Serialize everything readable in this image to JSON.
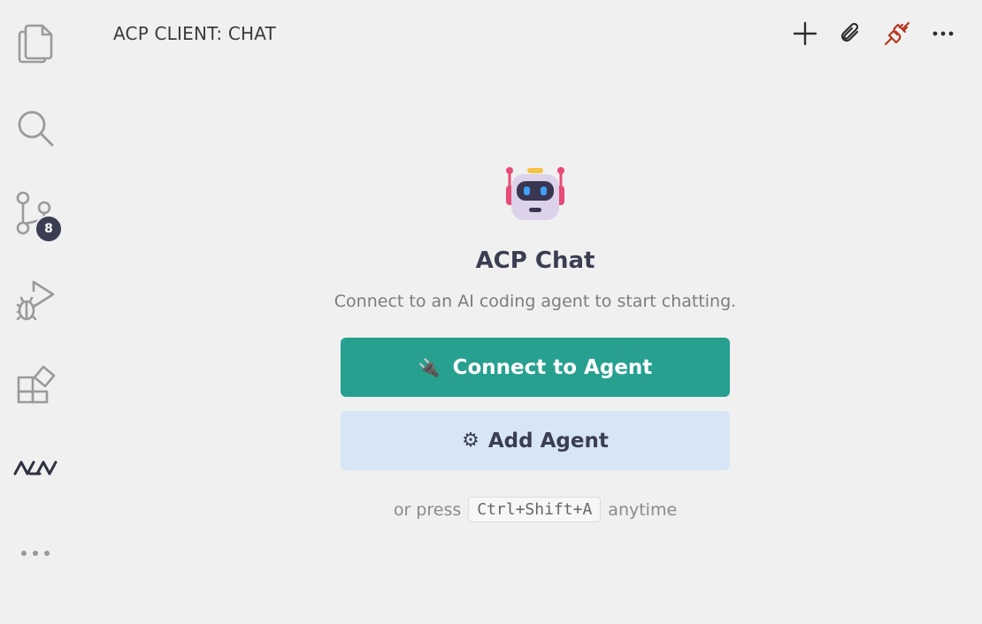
{
  "activity_bar": {
    "items": [
      {
        "name": "explorer",
        "icon": "files-icon"
      },
      {
        "name": "search",
        "icon": "search-icon"
      },
      {
        "name": "source-control",
        "icon": "source-control-icon",
        "badge": "8"
      },
      {
        "name": "run-debug",
        "icon": "run-debug-icon"
      },
      {
        "name": "extensions",
        "icon": "extensions-icon"
      },
      {
        "name": "acp",
        "icon": "acp-logo-icon"
      },
      {
        "name": "more",
        "icon": "ellipsis-icon"
      }
    ]
  },
  "header": {
    "title": "ACP CLIENT: CHAT",
    "actions": [
      {
        "icon": "plus-icon"
      },
      {
        "icon": "paperclip-icon"
      },
      {
        "icon": "disconnected-plug-icon"
      },
      {
        "icon": "ellipsis-icon"
      }
    ]
  },
  "welcome": {
    "icon": "robot-icon",
    "title": "ACP Chat",
    "subtitle": "Connect to an AI coding agent to start chatting.",
    "connect_icon": "🔌",
    "connect_label": "Connect to Agent",
    "add_icon": "⚙",
    "add_label": "Add Agent",
    "hint_prefix": "or press",
    "hint_shortcut": "Ctrl+Shift+A",
    "hint_suffix": "anytime"
  },
  "colors": {
    "primary_button": "#27a090",
    "secondary_button": "#d6e6f6",
    "badge": "#3b3e52",
    "disconnected": "#b8371f"
  }
}
